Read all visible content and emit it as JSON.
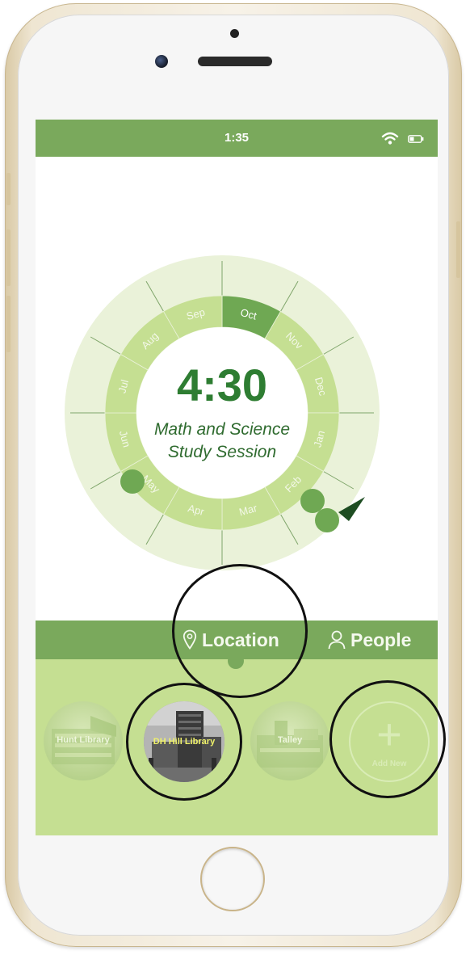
{
  "status_bar": {
    "time": "1:35",
    "wifi_icon": "wifi-icon",
    "battery_icon": "battery-icon"
  },
  "dial": {
    "countdown": "4:30",
    "event_line1": "Math and Science",
    "event_line2": "Study Session",
    "months": [
      "Oct",
      "Nov",
      "Dec",
      "Jan",
      "Feb",
      "Mar",
      "Apr",
      "May",
      "Jun",
      "Jul",
      "Aug",
      "Sep"
    ],
    "selected_month": "Oct",
    "colors": {
      "outer": "#eaf2d9",
      "ring": "#c5df92",
      "selected": "#6fa853",
      "accent": "#1e4d22",
      "text": "#2e6b35"
    }
  },
  "tabs": {
    "location_label": "Location",
    "location_icon": "map-pin-icon",
    "people_label": "People",
    "people_icon": "person-icon"
  },
  "locations": [
    {
      "label": "Hunt Library"
    },
    {
      "label": "DH Hill Library"
    },
    {
      "label": "Talley"
    }
  ],
  "add_new": {
    "label": "Add New",
    "icon": "plus-icon"
  },
  "theme": {
    "green": "#7aa95c",
    "light_green": "#c5df92"
  }
}
